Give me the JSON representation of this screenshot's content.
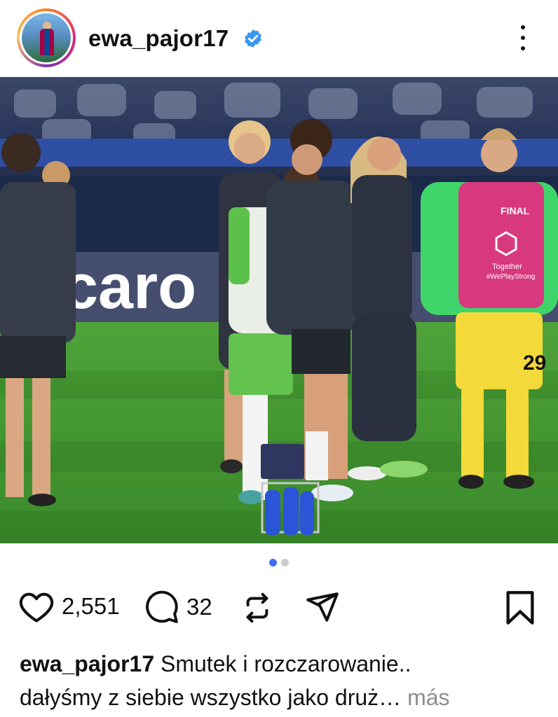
{
  "post": {
    "username": "ewa_pajor17",
    "verified": true,
    "likes": "2,551",
    "comments": "32",
    "caption_line1": "Smutek i rozczarowanie..",
    "caption_line2": "dałyśmy z siebie wszystko jako druż…",
    "more_label": "más",
    "carousel": {
      "count": 2,
      "active_index": 0
    }
  },
  "photo": {
    "board_text": "caro",
    "pink_bib_text_1": "FINAL",
    "pink_bib_text_2": "Together",
    "pink_bib_text_3": "#WePlayStrong",
    "shirt_number": "29"
  },
  "colors": {
    "accent_blue": "#3f6cf5",
    "verified_blue": "#3897f0",
    "pitch_green": "#3f9a2f",
    "bib_pink": "#d8397e"
  },
  "icons": [
    "heart-icon",
    "comment-icon",
    "repost-icon",
    "share-icon",
    "bookmark-icon",
    "more-options-icon",
    "verified-badge-icon"
  ]
}
